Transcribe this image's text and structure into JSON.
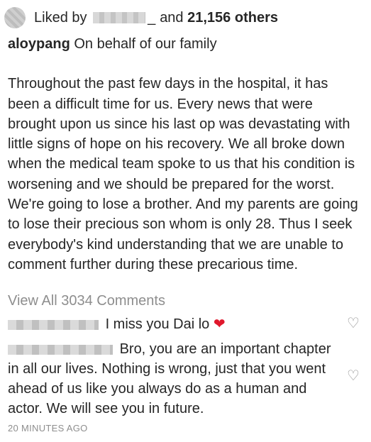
{
  "likes": {
    "prefix": "Liked by",
    "underscore": "_",
    "conjunction": "and",
    "count_text": "21,156 others"
  },
  "caption": {
    "username": "aloypang",
    "headline": "On behalf of our family",
    "body": "Throughout the past few days in the hospital, it has been a difficult time for us. Every news that were brought upon us since his last op was devastating with little signs of hope on his recovery. We all broke down when the medical team spoke to us that his condition is worsening and we should be prepared for the worst. We're going to lose a brother. And my parents are going to lose their precious son whom is only 28. Thus I seek everybody's kind understanding that we are unable to comment further during these precarious time."
  },
  "view_all_comments": "View All 3034 Comments",
  "comments": [
    {
      "text": "I miss you Dai lo",
      "emoji_icon": "red-heart-icon"
    },
    {
      "text": "Bro, you are an important chapter in all our lives. Nothing is wrong, just that you went ahead of us like you always do as a human and actor. We will see you in future."
    }
  ],
  "timestamp": "20 MINUTES AGO",
  "icons": {
    "like": "heart-outline-icon",
    "heart_glyph": "❤",
    "like_glyph": "♡"
  },
  "colors": {
    "accent_heart": "#e0182d",
    "muted": "#8e8e8e",
    "text": "#262626"
  }
}
